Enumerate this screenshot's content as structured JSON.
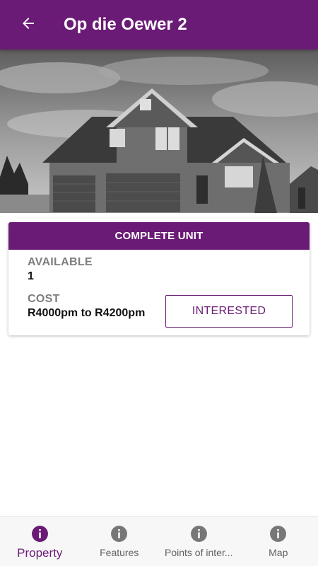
{
  "appbar": {
    "title": "Op die Oewer 2",
    "back_icon": "arrow-back-icon",
    "color": "#6a1b75"
  },
  "hero": {
    "image": "house-photo"
  },
  "card": {
    "header": "COMPLETE UNIT",
    "available_label": "AVAILABLE",
    "available_value": "1",
    "cost_label": "COST",
    "cost_value": "R4000pm to R4200pm",
    "interested_label": "INTERESTED"
  },
  "bottom_nav": {
    "items": [
      {
        "label": "Property",
        "icon": "info-icon",
        "active": true
      },
      {
        "label": "Features",
        "icon": "info-icon",
        "active": false
      },
      {
        "label": "Points of inter...",
        "icon": "info-icon",
        "active": false
      },
      {
        "label": "Map",
        "icon": "info-icon",
        "active": false
      }
    ],
    "active_color": "#6a1b75",
    "inactive_color": "#777777"
  }
}
